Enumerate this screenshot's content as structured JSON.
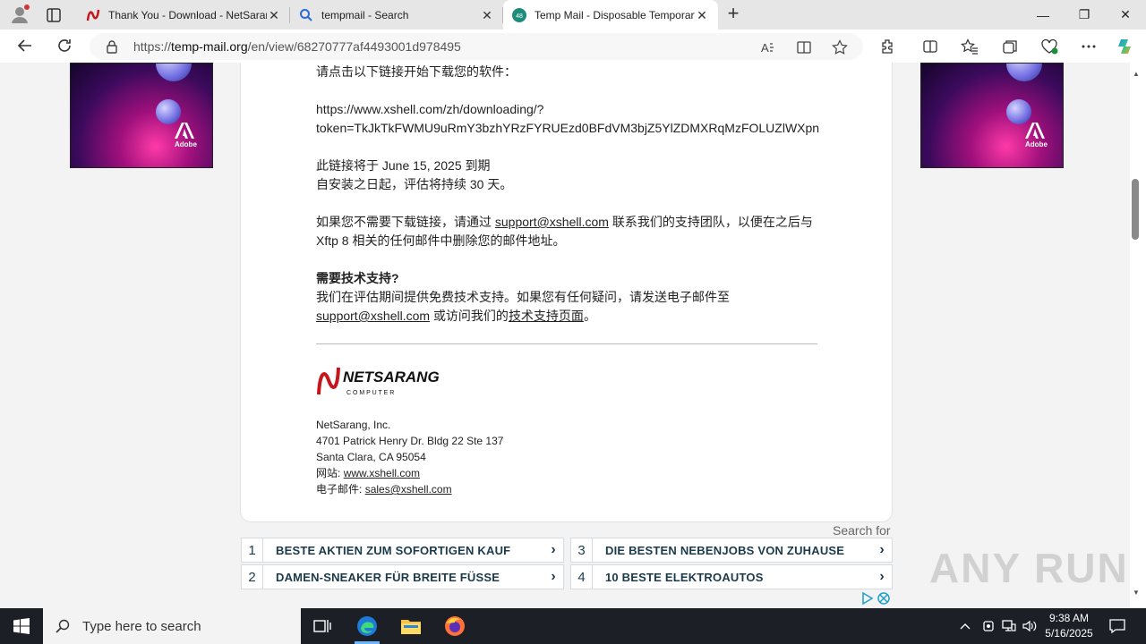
{
  "browser": {
    "tabs": [
      {
        "title": "Thank You - Download - NetSarang",
        "active": false
      },
      {
        "title": "tempmail - Search",
        "active": false
      },
      {
        "title": "Temp Mail - Disposable Temporary",
        "active": true
      }
    ],
    "close_glyph": "✕",
    "new_tab_glyph": "+",
    "address": {
      "prefix": "https://",
      "host": "temp-mail.org",
      "path": "/en/view/68270777af4493001d978495"
    },
    "window_controls": {
      "minimize": "—",
      "maximize": "❐",
      "close": "✕"
    }
  },
  "email": {
    "intro": "请点击以下链接开始下载您的软件：",
    "link_line1": "https://www.xshell.com/zh/downloading/?",
    "link_line2": "token=TkJkTkFWMU9uRmY3bzhYRzFYRUEzd0BFdVM3bjZ5YlZDMXRqMzFOLUZlWXpn",
    "expire": "此链接将于 June 15, 2025 到期",
    "eval": "自安装之日起，评估将持续 30 天。",
    "unsub_pre": "如果您不需要下载链接，请通过",
    "unsub_email": "support@xshell.com",
    "unsub_post": "联系我们的支持团队，以便在之后与",
    "unsub_line2": "Xftp 8 相关的任何邮件中删除您的邮件地址。",
    "support_title": "需要技术支持?",
    "support_line1": "我们在评估期间提供免费技术支持。如果您有任何疑问，请发送电子邮件至",
    "support_email": "support@xshell.com",
    "support_mid": "或访问我们的",
    "support_link": "技术支持页面",
    "support_end": "。",
    "company": "NetSarang, Inc.",
    "street": "4701 Patrick Henry Dr. Bldg 22 Ste 137",
    "city": "Santa Clara, CA 95054",
    "web_label": "网站:",
    "web": "www.xshell.com",
    "mail_label": "电子邮件:",
    "mail": "sales@xshell.com",
    "logo_text": "NETSARANG",
    "logo_sub": "C O M P U T E R"
  },
  "ads": {
    "side_logo": "Adobe",
    "search_for": "Search for",
    "links": [
      {
        "num": "1",
        "label": "BESTE AKTIEN ZUM SOFORTIGEN KAUF"
      },
      {
        "num": "2",
        "label": "DAMEN-SNEAKER FÜR BREITE FÜSSE"
      },
      {
        "num": "3",
        "label": "DIE BESTEN NEBENJOBS VON ZUHAUSE"
      },
      {
        "num": "4",
        "label": "10 BESTE ELEKTROAUTOS"
      }
    ],
    "chevron": "›"
  },
  "watermark": "ANY RUN",
  "taskbar": {
    "search_placeholder": "Type here to search",
    "time": "9:38 AM",
    "date": "5/16/2025"
  }
}
